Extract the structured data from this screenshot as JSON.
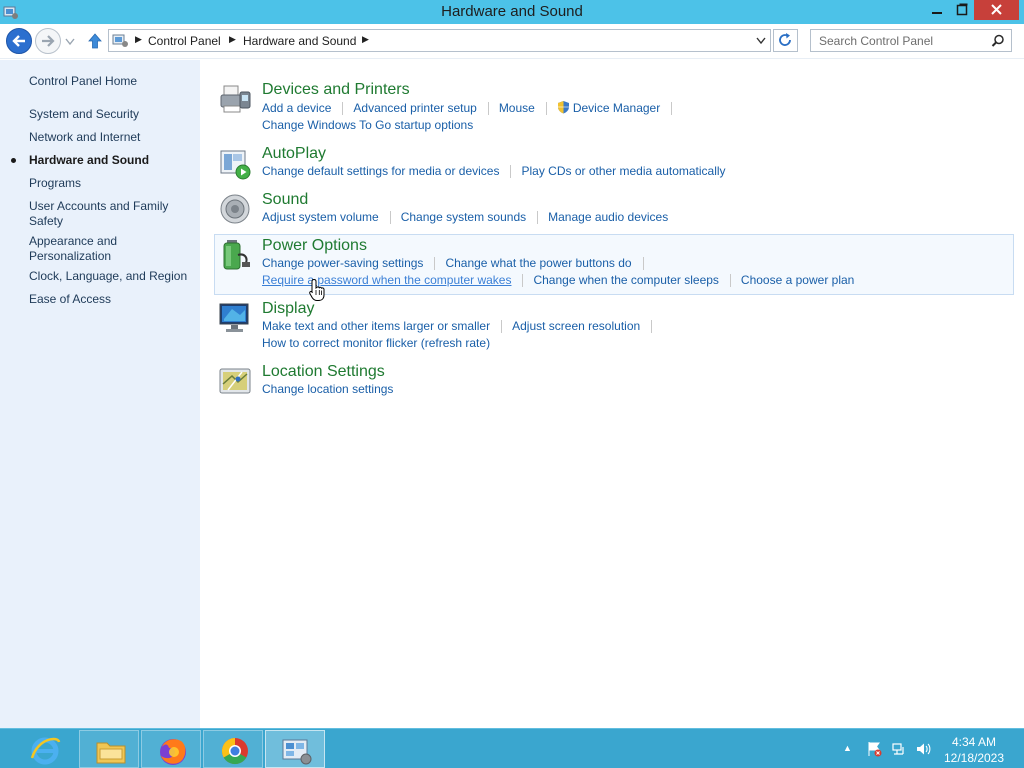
{
  "window": {
    "title": "Hardware and Sound",
    "controls": {
      "minimize": "minimize-icon",
      "maximize": "restore-icon",
      "close": "close-icon"
    }
  },
  "navigation": {
    "breadcrumb": [
      "Control Panel",
      "Hardware and Sound"
    ],
    "search_placeholder": "Search Control Panel"
  },
  "sidebar": {
    "home": "Control Panel Home",
    "items": [
      {
        "label": "System and Security",
        "active": false
      },
      {
        "label": "Network and Internet",
        "active": false
      },
      {
        "label": "Hardware and Sound",
        "active": true
      },
      {
        "label": "Programs",
        "active": false
      },
      {
        "label": "User Accounts and Family Safety",
        "active": false
      },
      {
        "label": "Appearance and Personalization",
        "active": false
      },
      {
        "label": "Clock, Language, and Region",
        "active": false
      },
      {
        "label": "Ease of Access",
        "active": false
      }
    ]
  },
  "categories": [
    {
      "title": "Devices and Printers",
      "icon": "printer-icon",
      "links": [
        "Add a device",
        "Advanced printer setup",
        "Mouse",
        "Device Manager",
        "Change Windows To Go startup options"
      ]
    },
    {
      "title": "AutoPlay",
      "icon": "autoplay-icon",
      "links": [
        "Change default settings for media or devices",
        "Play CDs or other media automatically"
      ]
    },
    {
      "title": "Sound",
      "icon": "speaker-icon",
      "links": [
        "Adjust system volume",
        "Change system sounds",
        "Manage audio devices"
      ]
    },
    {
      "title": "Power Options",
      "icon": "battery-icon",
      "links": [
        "Change power-saving settings",
        "Change what the power buttons do",
        "Require a password when the computer wakes",
        "Change when the computer sleeps",
        "Choose a power plan"
      ]
    },
    {
      "title": "Display",
      "icon": "monitor-icon",
      "links": [
        "Make text and other items larger or smaller",
        "Adjust screen resolution",
        "How to correct monitor flicker (refresh rate)"
      ]
    },
    {
      "title": "Location Settings",
      "icon": "map-icon",
      "links": [
        "Change location settings"
      ]
    }
  ],
  "taskbar": {
    "apps": [
      "internet-explorer-icon",
      "file-explorer-icon",
      "firefox-icon",
      "chrome-icon",
      "control-panel-icon"
    ],
    "tray": [
      "action-center-icon",
      "network-icon",
      "volume-icon"
    ],
    "time": "4:34 AM",
    "date": "12/18/2023"
  }
}
